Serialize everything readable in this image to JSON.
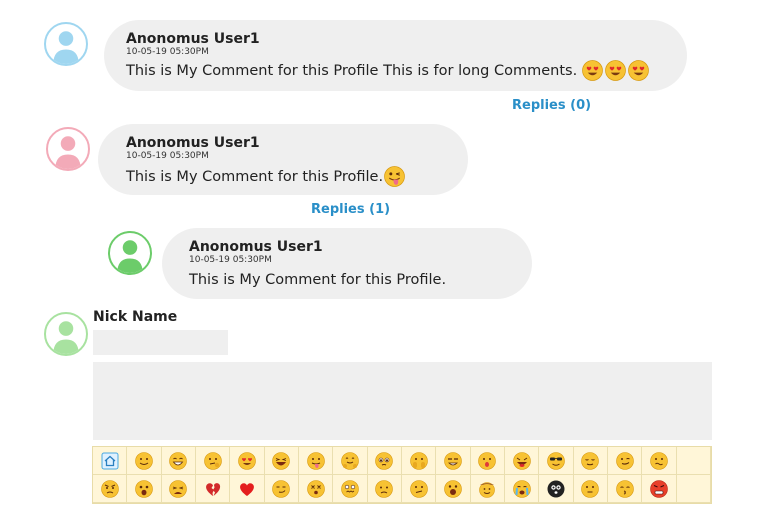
{
  "comments": [
    {
      "author": "Anonomus User1",
      "timestamp": "10-05-19 05:30PM",
      "text": "This is My Comment for this Profile This is for long Comments.",
      "emoji": [
        "heart-eyes",
        "heart-eyes",
        "heart-eyes"
      ],
      "avatar_color": "#9fd6f0",
      "replies_label": "Replies (0)"
    },
    {
      "author": "Anonomus User1",
      "timestamp": "10-05-19 05:30PM",
      "text": "This is My Comment for this Profile.",
      "emoji": [
        "tongue-wink"
      ],
      "avatar_color": "#f3aab8",
      "replies_label": "Replies (1)"
    }
  ],
  "reply": {
    "author": "Anonomus User1",
    "timestamp": "10-05-19 05:30PM",
    "text": "This is My Comment for this Profile.",
    "avatar_color": "#6ccc6a"
  },
  "composer": {
    "nick_label": "Nick Name",
    "nick_value": "",
    "comment_value": "",
    "avatar_color": "#a8e2a0"
  },
  "emoji_palette": [
    "home-icon",
    "smile",
    "grin",
    "thinking",
    "heart-eyes",
    "laughing",
    "tongue",
    "hug",
    "pleading",
    "raised-hands",
    "star-struck",
    "surprised",
    "tongue-red",
    "sunglasses",
    "relieved",
    "wink",
    "hush",
    "angry",
    "shocked",
    "tired",
    "broken-heart",
    "red-heart",
    "smirk",
    "dizzy",
    "nauseated",
    "worried",
    "confused",
    "open-mouth",
    "cowboy",
    "crying",
    "ghost",
    "neutral",
    "kiss",
    "rage"
  ],
  "colors": {
    "link": "#2a8fc8",
    "bubble": "#efefef",
    "emoji_bg": "#fff6d8"
  }
}
